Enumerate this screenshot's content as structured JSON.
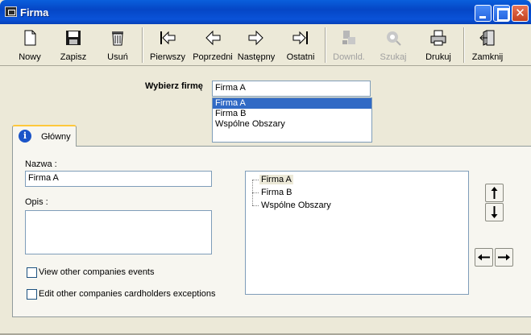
{
  "window": {
    "title": "Firma"
  },
  "toolbar": {
    "buttons": [
      {
        "label": "Nowy",
        "icon": "new-document-icon",
        "enabled": true
      },
      {
        "label": "Zapisz",
        "icon": "floppy-disk-icon",
        "enabled": true
      },
      {
        "label": "Usuń",
        "icon": "trash-can-icon",
        "enabled": true
      },
      {
        "label": "Pierwszy",
        "icon": "first-arrow-icon",
        "enabled": true
      },
      {
        "label": "Poprzedni",
        "icon": "previous-arrow-icon",
        "enabled": true
      },
      {
        "label": "Następny",
        "icon": "next-arrow-icon",
        "enabled": true
      },
      {
        "label": "Ostatni",
        "icon": "last-arrow-icon",
        "enabled": true
      },
      {
        "label": "Downld.",
        "icon": "download-icon",
        "enabled": false
      },
      {
        "label": "Szukaj",
        "icon": "search-icon",
        "enabled": false
      },
      {
        "label": "Drukuj",
        "icon": "printer-icon",
        "enabled": true
      },
      {
        "label": "Zamknij",
        "icon": "exit-door-icon",
        "enabled": true
      }
    ]
  },
  "chooser": {
    "label": "Wybierz firmę",
    "value": "Firma A",
    "options": [
      "Firma A",
      "Firma B",
      "Wspólne Obszary"
    ],
    "selected_index": 0
  },
  "tab": {
    "label": "Główny",
    "icon": "info-icon"
  },
  "form": {
    "name_label": "Nazwa :",
    "name_value": "Firma A",
    "desc_label": "Opis :",
    "desc_value": "",
    "checkbox_view_label": "View other companies events",
    "checkbox_view_checked": false,
    "checkbox_edit_label": "Edit other companies cardholders exceptions",
    "checkbox_edit_checked": false
  },
  "tree": {
    "items": [
      "Firma A",
      "Firma B",
      "Wspólne Obszary"
    ],
    "selected_index": 0
  },
  "arrows": {
    "up": "🡅",
    "down": "🡇",
    "left": "🡄",
    "right": "🡆"
  },
  "colors": {
    "titlebar": "#0a52d8",
    "selection": "#316ac5",
    "face": "#ece9d8"
  }
}
